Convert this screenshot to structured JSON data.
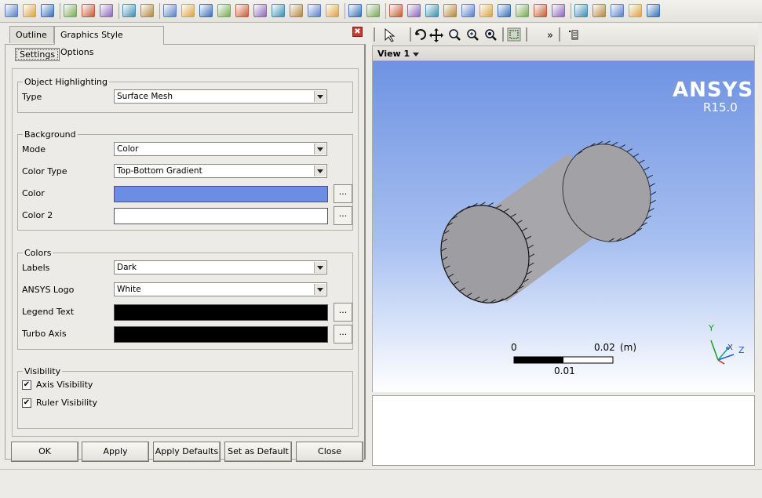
{
  "toolbar": {
    "icons": [
      "new-icon",
      "open-icon",
      "save-icon",
      "import-icon",
      "export-icon",
      "screenshot-icon",
      "undo-icon",
      "redo-icon",
      "folder-open-icon",
      "model-icon",
      "select-icon",
      "mesh-icon",
      "physics-icon",
      "flame-icon",
      "variables-icon",
      "expression-icon",
      "subdomain-icon",
      "function-icon",
      "timestep-icon",
      "animation-icon",
      "domain-icon",
      "boundary-icon",
      "subdomain-box-icon",
      "interface-icon",
      "mesh-adaption-icon",
      "init-icon",
      "monitor-icon",
      "solver-control-icon",
      "flow-icon",
      "copy-icon",
      "paste-icon",
      "run-icon",
      "edit-icon",
      "report-icon",
      "export-report-icon"
    ]
  },
  "left_panel": {
    "tabs": [
      {
        "label": "Outline"
      },
      {
        "label": "Graphics Style Options"
      }
    ],
    "close_symbol": "✖",
    "subtab": "Settings",
    "groups": {
      "object_highlighting": {
        "title": "Object Highlighting",
        "type_label": "Type",
        "type_value": "Surface Mesh"
      },
      "background": {
        "title": "Background",
        "mode_label": "Mode",
        "mode_value": "Color",
        "color_type_label": "Color Type",
        "color_type_value": "Top-Bottom Gradient",
        "color_label": "Color",
        "color_value": "#6b8de3",
        "color2_label": "Color 2",
        "color2_value": "#ffffff",
        "picker_label": "..."
      },
      "colors": {
        "title": "Colors",
        "labels_label": "Labels",
        "labels_value": "Dark",
        "logo_label": "ANSYS Logo",
        "logo_value": "White",
        "legend_text_label": "Legend Text",
        "legend_text_color": "#000000",
        "turbo_axis_label": "Turbo Axis",
        "turbo_axis_color": "#000000",
        "picker_label": "..."
      },
      "visibility": {
        "title": "Visibility",
        "axis_label": "Axis Visibility",
        "axis_checked": true,
        "ruler_label": "Ruler Visibility",
        "ruler_checked": true,
        "check_mark": "✔"
      }
    },
    "buttons": {
      "ok": "OK",
      "apply": "Apply",
      "apply_defaults": "Apply Defaults",
      "set_default": "Set as Default",
      "close": "Close"
    }
  },
  "view": {
    "title": "View 1",
    "logo_name": "ANSYS",
    "logo_release": "R15.0",
    "ruler": {
      "start": "0",
      "end": "0.02",
      "unit": "(m)",
      "mid": "0.01"
    },
    "axes": {
      "y": "Y",
      "x": "X",
      "z": "Z"
    },
    "more_symbol": "»"
  }
}
